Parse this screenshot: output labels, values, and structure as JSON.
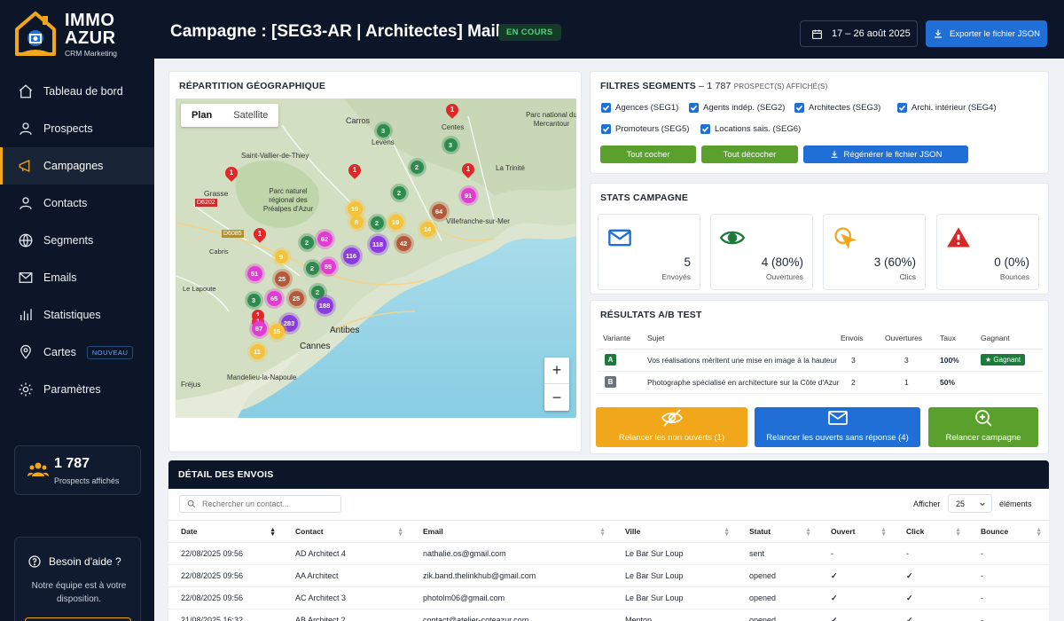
{
  "brand": {
    "line1": "IMMO",
    "line2": "AZUR",
    "subtitle": "CRM Marketing"
  },
  "nav": [
    {
      "label": "Tableau de bord",
      "icon": "home-icon"
    },
    {
      "label": "Prospects",
      "icon": "user-icon"
    },
    {
      "label": "Campagnes",
      "icon": "megaphone-icon",
      "active": true
    },
    {
      "label": "Contacts",
      "icon": "contact-icon"
    },
    {
      "label": "Segments",
      "icon": "globe-icon"
    },
    {
      "label": "Emails",
      "icon": "mail-icon"
    },
    {
      "label": "Statistiques",
      "icon": "bar-chart-icon"
    },
    {
      "label": "Cartes",
      "icon": "map-pin-icon",
      "badge": "NOUVEAU"
    },
    {
      "label": "Paramètres",
      "icon": "gear-icon"
    }
  ],
  "sidebar_stat": {
    "value": "1 787",
    "label": "Prospects affichés"
  },
  "help": {
    "title": "Besoin d'aide ?",
    "text": "Notre équipe est à votre disposition."
  },
  "header": {
    "title": "Campagne : [SEG3-AR | Architectes] Mail 1",
    "status": "EN COURS",
    "date_range": "17 – 26 août 2025",
    "export_label": "Exporter le fichier JSON"
  },
  "map": {
    "title": "RÉPARTITION GÉOGRAPHIQUE",
    "tabs": [
      "Plan",
      "Satellite"
    ],
    "zoom_in": "+",
    "zoom_out": "−",
    "places": [
      {
        "name": "Carros"
      },
      {
        "name": "Parc national du Mercantour"
      },
      {
        "name": "Centes"
      },
      {
        "name": "Levens"
      },
      {
        "name": "Saint-Vallier-de-Thiey"
      },
      {
        "name": "La Trinité"
      },
      {
        "name": "Grasse"
      },
      {
        "name": "Parc naturel régional des Préalpes d'Azur"
      },
      {
        "name": "Villefranche-sur-Mer"
      },
      {
        "name": "Cabris"
      },
      {
        "name": "Antibes"
      },
      {
        "name": "Cannes"
      },
      {
        "name": "Mandelieu-la-Napoule"
      },
      {
        "name": "Fréjus"
      },
      {
        "name": "Le Lapoute"
      },
      {
        "name": "D6202"
      },
      {
        "name": "D6085"
      }
    ],
    "clusters": [
      {
        "count": "1",
        "kind": "pin"
      },
      {
        "count": "3",
        "kind": "green"
      },
      {
        "count": "3",
        "kind": "green"
      },
      {
        "count": "1",
        "kind": "pin"
      },
      {
        "count": "2",
        "kind": "green"
      },
      {
        "count": "1",
        "kind": "pin"
      },
      {
        "count": "1",
        "kind": "pin"
      },
      {
        "count": "2",
        "kind": "green"
      },
      {
        "count": "91",
        "kind": "magenta"
      },
      {
        "count": "19",
        "kind": "yellow"
      },
      {
        "count": "8",
        "kind": "yellow"
      },
      {
        "count": "2",
        "kind": "green"
      },
      {
        "count": "19",
        "kind": "yellow"
      },
      {
        "count": "64",
        "kind": "brown"
      },
      {
        "count": "14",
        "kind": "yellow"
      },
      {
        "count": "1",
        "kind": "pin"
      },
      {
        "count": "2",
        "kind": "green"
      },
      {
        "count": "62",
        "kind": "magenta"
      },
      {
        "count": "116",
        "kind": "purple"
      },
      {
        "count": "118",
        "kind": "purple"
      },
      {
        "count": "42",
        "kind": "brown"
      },
      {
        "count": "9",
        "kind": "yellow"
      },
      {
        "count": "2",
        "kind": "green"
      },
      {
        "count": "51",
        "kind": "magenta"
      },
      {
        "count": "55",
        "kind": "magenta"
      },
      {
        "count": "25",
        "kind": "brown"
      },
      {
        "count": "2",
        "kind": "green"
      },
      {
        "count": "1",
        "kind": "pin"
      },
      {
        "count": "3",
        "kind": "green"
      },
      {
        "count": "65",
        "kind": "magenta"
      },
      {
        "count": "25",
        "kind": "brown"
      },
      {
        "count": "188",
        "kind": "purple"
      },
      {
        "count": "1",
        "kind": "pin"
      },
      {
        "count": "67",
        "kind": "magenta"
      },
      {
        "count": "283",
        "kind": "purple"
      },
      {
        "count": "15",
        "kind": "yellow"
      },
      {
        "count": "11",
        "kind": "yellow"
      }
    ]
  },
  "filters": {
    "title": "FILTRES SEGMENTS",
    "count": "1 787",
    "count_suffix": "PROSPECT(S) AFFICHÉ(S)",
    "segments": [
      "Agences (SEG1)",
      "Agents indép. (SEG2)",
      "Architectes (SEG3)",
      "Archi. intérieur (SEG4)",
      "Promoteurs (SEG5)",
      "Locations sais. (SEG6)"
    ],
    "btn_check_all": "Tout cocher",
    "btn_uncheck_all": "Tout décocher",
    "btn_regen": "Régénérer le fichier JSON"
  },
  "stats": {
    "title": "STATS CAMPAGNE",
    "cards": [
      {
        "value": "5",
        "label": "Envoyés"
      },
      {
        "value": "4 (80%)",
        "label": "Ouvertures"
      },
      {
        "value": "3 (60%)",
        "label": "Clics"
      },
      {
        "value": "0 (0%)",
        "label": "Bounces"
      }
    ]
  },
  "ab": {
    "title": "RÉSULTATS A/B TEST",
    "headers": [
      "Variante",
      "Sujet",
      "Envois",
      "Ouvertures",
      "Taux",
      "Gagnant"
    ],
    "rows": [
      {
        "variant": "A",
        "subject": "Vos réalisations méritent une mise en image à la hauteur",
        "sent": "3",
        "opens": "3",
        "rate": "100%",
        "winner": "★ Gagnant"
      },
      {
        "variant": "B",
        "subject": "Photographe spécialisé en architecture sur la Côte d'Azur",
        "sent": "2",
        "opens": "1",
        "rate": "50%",
        "winner": ""
      }
    ]
  },
  "actions": [
    {
      "label": "Relancer les non ouverts (1)",
      "color": "#f2a619"
    },
    {
      "label": "Relancer les ouverts sans réponse (4)",
      "color": "#1f6fd6"
    },
    {
      "label": "Relancer campagne",
      "color": "#5aa02c"
    }
  ],
  "detail": {
    "title": "DÉTAIL DES ENVOIS",
    "search_placeholder": "Rechercher un contact...",
    "show_label": "Afficher",
    "show_value": "25",
    "elements_label": "éléments",
    "headers": [
      "Date",
      "Contact",
      "Email",
      "Ville",
      "Statut",
      "Ouvert",
      "Click",
      "Bounce"
    ],
    "rows": [
      [
        "22/08/2025 09:56",
        "AD Architect 4",
        "nathalie.os@gmail.com",
        "Le Bar Sur Loup",
        "sent",
        "-",
        "-",
        "-"
      ],
      [
        "22/08/2025 09:56",
        "AA Architect",
        "zik.band.thelinkhub@gmail.com",
        "Le Bar Sur Loup",
        "opened",
        "✓",
        "✓",
        "-"
      ],
      [
        "22/08/2025 09:56",
        "AC Architect 3",
        "photolm06@gmail.com",
        "Le Bar Sur Loup",
        "opened",
        "✓",
        "✓",
        "-"
      ],
      [
        "21/08/2025 16:32",
        "AB Architect 2",
        "contact@atelier-coteazur.com",
        "Menton",
        "opened",
        "✓",
        "✓",
        "-"
      ]
    ]
  }
}
